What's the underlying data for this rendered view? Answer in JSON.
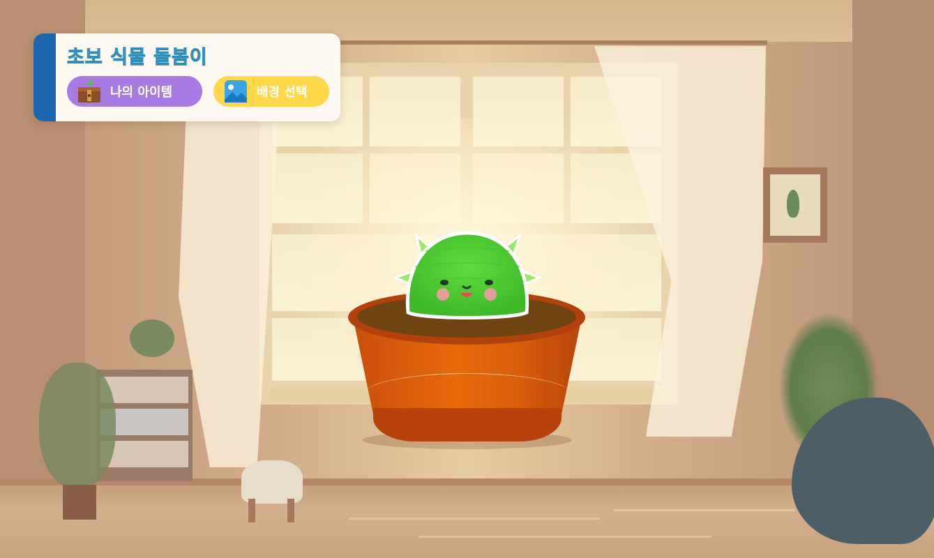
{
  "header": {
    "title": "초보 식물 돌봄이"
  },
  "buttons": {
    "items": {
      "label": "나의 아이템",
      "icon": "treasure-chest-icon",
      "color": "#a97ae3"
    },
    "background": {
      "label": "배경 선택",
      "icon": "picture-icon",
      "color": "#ffd84a"
    }
  },
  "colors": {
    "panel_accent": "#1b66ad",
    "title": "#53c7e6",
    "pot": "#e86a0a",
    "plant": "#5ed63d"
  }
}
